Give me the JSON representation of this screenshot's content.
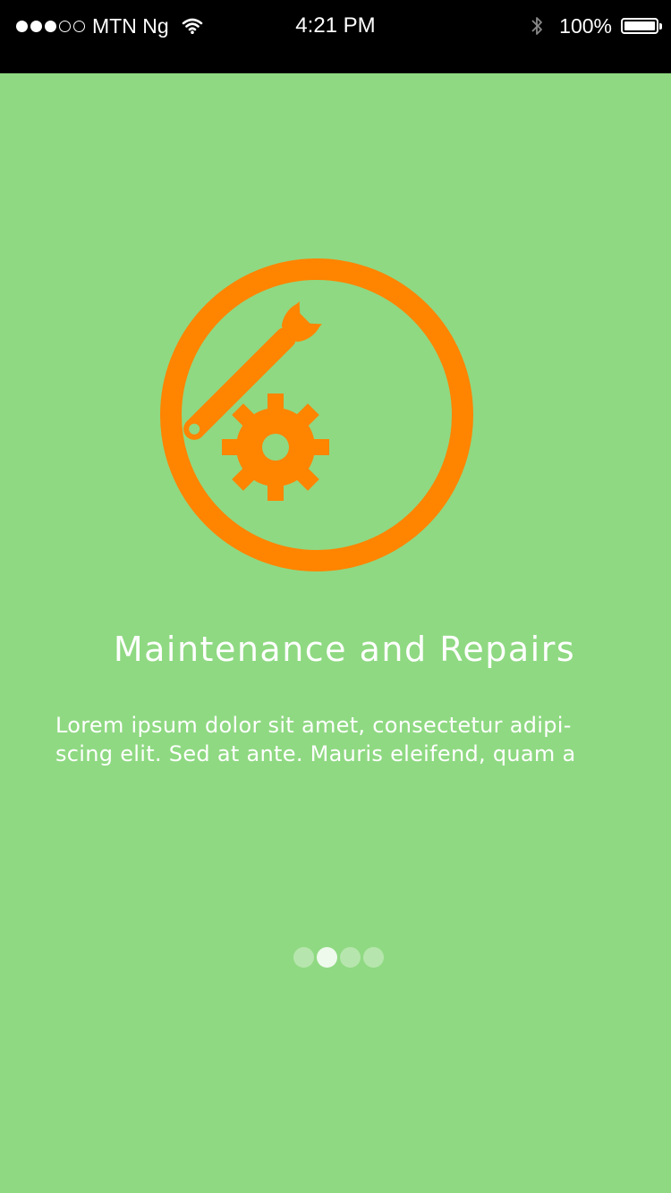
{
  "status_bar": {
    "carrier": "MTN Ng",
    "time": "4:21 PM",
    "battery_percent": "100%",
    "signal_bars_filled": 3,
    "signal_bars_total": 5,
    "battery_level": 1.0
  },
  "onboarding": {
    "icon": "maintenance-wrench-gear-icon",
    "title": "Maintenance and Repairs",
    "description": "Lorem ipsum dolor sit amet, consectetur adipi-scing elit. Sed at ante. Mauris eleifend, quam a",
    "page_indicator": {
      "total": 4,
      "current": 2
    }
  },
  "colors": {
    "background": "#8fd982",
    "accent": "#ff8400",
    "status_bar": "#000000",
    "text": "#ffffff"
  }
}
